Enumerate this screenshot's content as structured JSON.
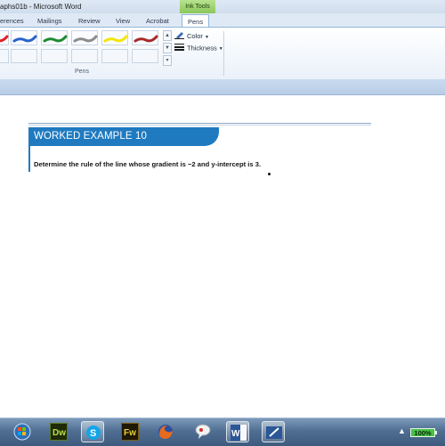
{
  "window": {
    "title": "aphs01b - Microsoft Word",
    "contextual_tab": "Ink Tools"
  },
  "ribbon_tabs": [
    {
      "label": "erences"
    },
    {
      "label": "Mailings"
    },
    {
      "label": "Review"
    },
    {
      "label": "View"
    },
    {
      "label": "Acrobat"
    },
    {
      "label": "Pens",
      "active": true
    }
  ],
  "pens_group": {
    "label": "Pens",
    "pen_colors": [
      "#e0202a",
      "#2a62c9",
      "#1f8a32",
      "#8c8c8c",
      "#f3e600",
      "#a82a2a"
    ],
    "color_label": "Color",
    "thickness_label": "Thickness"
  },
  "document": {
    "banner_title": "WORKED EXAMPLE 10",
    "question": "Determine the rule of the line whose gradient is −2 and y-intercept is 3.",
    "accent_color": "#1f7ac0"
  },
  "taskbar": {
    "apps": [
      {
        "icon": "start-orb-icon"
      },
      {
        "icon": "dreamweaver-icon",
        "label": "Dw"
      },
      {
        "icon": "skype-icon"
      },
      {
        "icon": "fireworks-icon",
        "label": "Fw"
      },
      {
        "icon": "firefox-icon"
      },
      {
        "icon": "chat-icon"
      },
      {
        "icon": "word-icon",
        "label": "W"
      },
      {
        "icon": "pen-tablet-icon"
      }
    ],
    "battery": "100%"
  }
}
